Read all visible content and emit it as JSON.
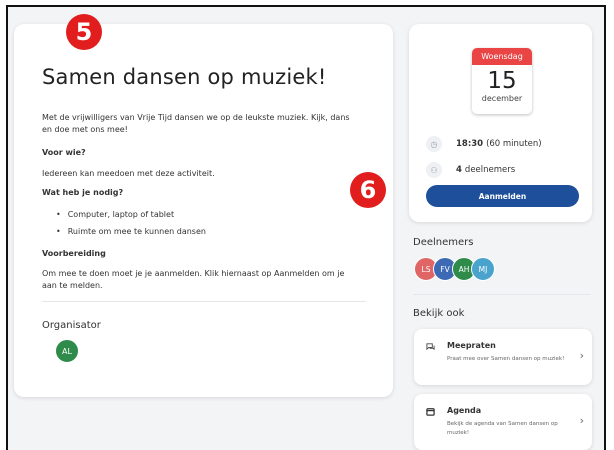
{
  "badges": {
    "left": "5",
    "right": "6"
  },
  "main": {
    "title": "Samen dansen op muziek!",
    "intro": "Met de vrijwilligers van Vrije Tijd dansen we op de leukste muziek. Kijk, dans en doe met ons mee!",
    "for_who_heading": "Voor wie?",
    "for_who_text": "Iedereen kan meedoen met deze activiteit.",
    "need_heading": "Wat heb je nodig?",
    "need_items": [
      "Computer, laptop of tablet",
      "Ruimte om mee te kunnen dansen"
    ],
    "prep_heading": "Voorbereiding",
    "prep_text": "Om mee te doen moet je je aanmelden. Klik hiernaast op Aanmelden om je aan te melden.",
    "organizer_label": "Organisator",
    "organizer_initials": "AL"
  },
  "event": {
    "weekday": "Woensdag",
    "day": "15",
    "month": "december",
    "time_bold": "18:30",
    "time_rest": "(60 minuten)",
    "participants_bold": "4",
    "participants_rest": "deelnemers",
    "signup_label": "Aanmelden"
  },
  "participants": {
    "label": "Deelnemers",
    "avatars": [
      {
        "initials": "LS",
        "color": "#e06666"
      },
      {
        "initials": "FV",
        "color": "#3d6ab5"
      },
      {
        "initials": "AH",
        "color": "#2e8b4a"
      },
      {
        "initials": "MJ",
        "color": "#4aa3cc"
      }
    ]
  },
  "see_also": {
    "label": "Bekijk ook",
    "items": [
      {
        "title": "Meepraten",
        "desc": "Praat mee over Samen dansen op muziek!",
        "icon": "chat-icon"
      },
      {
        "title": "Agenda",
        "desc": "Bekijk de agenda van Samen dansen op muziek!",
        "icon": "calendar-icon"
      }
    ]
  },
  "colors": {
    "primary": "#1d4f9a",
    "badge": "#e11d1d",
    "calendar_head": "#e94545"
  }
}
